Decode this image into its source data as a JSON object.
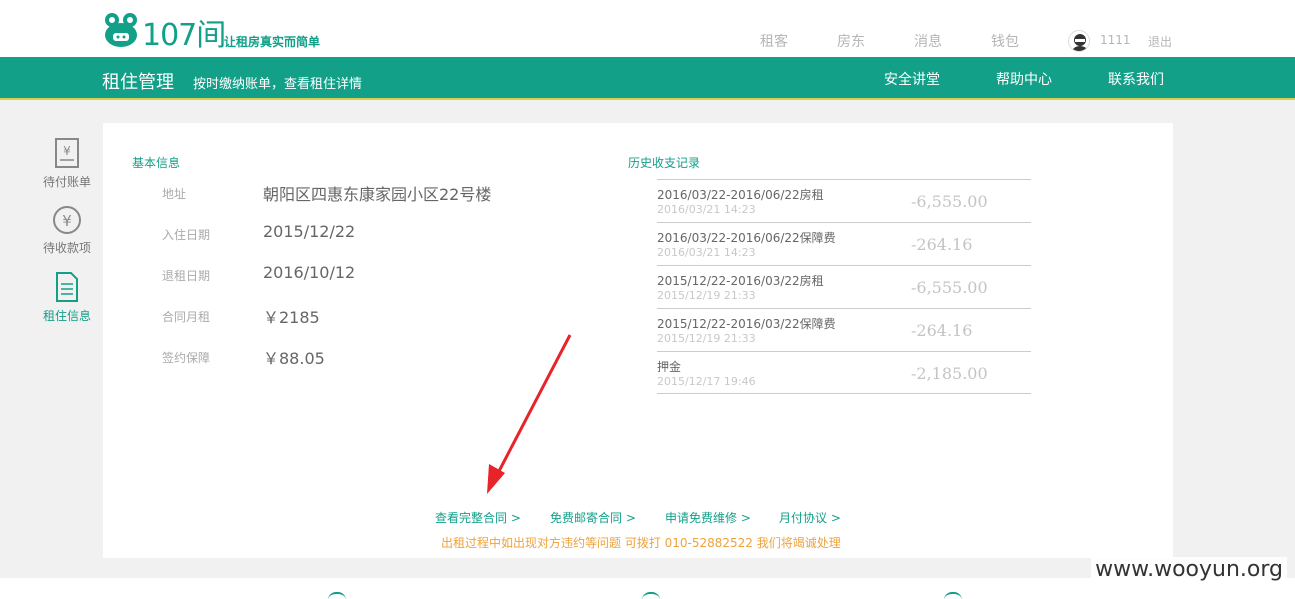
{
  "header": {
    "slogan": "让租房真实而简单",
    "logo_text": "107间",
    "nav": [
      "租客",
      "房东",
      "消息",
      "钱包"
    ],
    "username": "1111",
    "logout": "退出"
  },
  "greenbar": {
    "title": "租住管理",
    "subtitle": "按时缴纳账单，查看租住详情",
    "links": [
      "安全讲堂",
      "帮助中心",
      "联系我们"
    ]
  },
  "sidenav": [
    {
      "label": "待付账单",
      "icon": "bill-icon"
    },
    {
      "label": "待收款项",
      "icon": "yuan-circle-icon"
    },
    {
      "label": "租住信息",
      "icon": "document-icon",
      "active": true
    }
  ],
  "basic_info": {
    "title": "基本信息",
    "rows": [
      {
        "label": "地址",
        "value": "朝阳区四惠东康家园小区22号楼"
      },
      {
        "label": "入住日期",
        "value": "2015/12/22"
      },
      {
        "label": "退租日期",
        "value": "2016/10/12"
      },
      {
        "label": "合同月租",
        "value": "￥2185"
      },
      {
        "label": "签约保障",
        "value": "￥88.05"
      }
    ]
  },
  "history": {
    "title": "历史收支记录",
    "rows": [
      {
        "desc": "2016/03/22-2016/06/22房租",
        "time": "2016/03/21 14:23",
        "amount": "-6,555.00"
      },
      {
        "desc": "2016/03/22-2016/06/22保障费",
        "time": "2016/03/21 14:23",
        "amount": "-264.16"
      },
      {
        "desc": "2015/12/22-2016/03/22房租",
        "time": "2015/12/19 21:33",
        "amount": "-6,555.00"
      },
      {
        "desc": "2015/12/22-2016/03/22保障费",
        "time": "2015/12/19 21:33",
        "amount": "-264.16"
      },
      {
        "desc": "押金",
        "time": "2015/12/17 19:46",
        "amount": "-2,185.00"
      }
    ]
  },
  "actions": [
    "查看完整合同 >",
    "免费邮寄合同 >",
    "申请免费维修 >",
    "月付协议 >"
  ],
  "notice": "出租过程中如出现对方违约等问题 可拨打 010-52882522 我们将竭诚处理",
  "watermark": "www.wooyun.org",
  "colors": {
    "brand": "#12a089",
    "notice": "#f0a23a",
    "annotation_arrow": "#e8232a"
  }
}
